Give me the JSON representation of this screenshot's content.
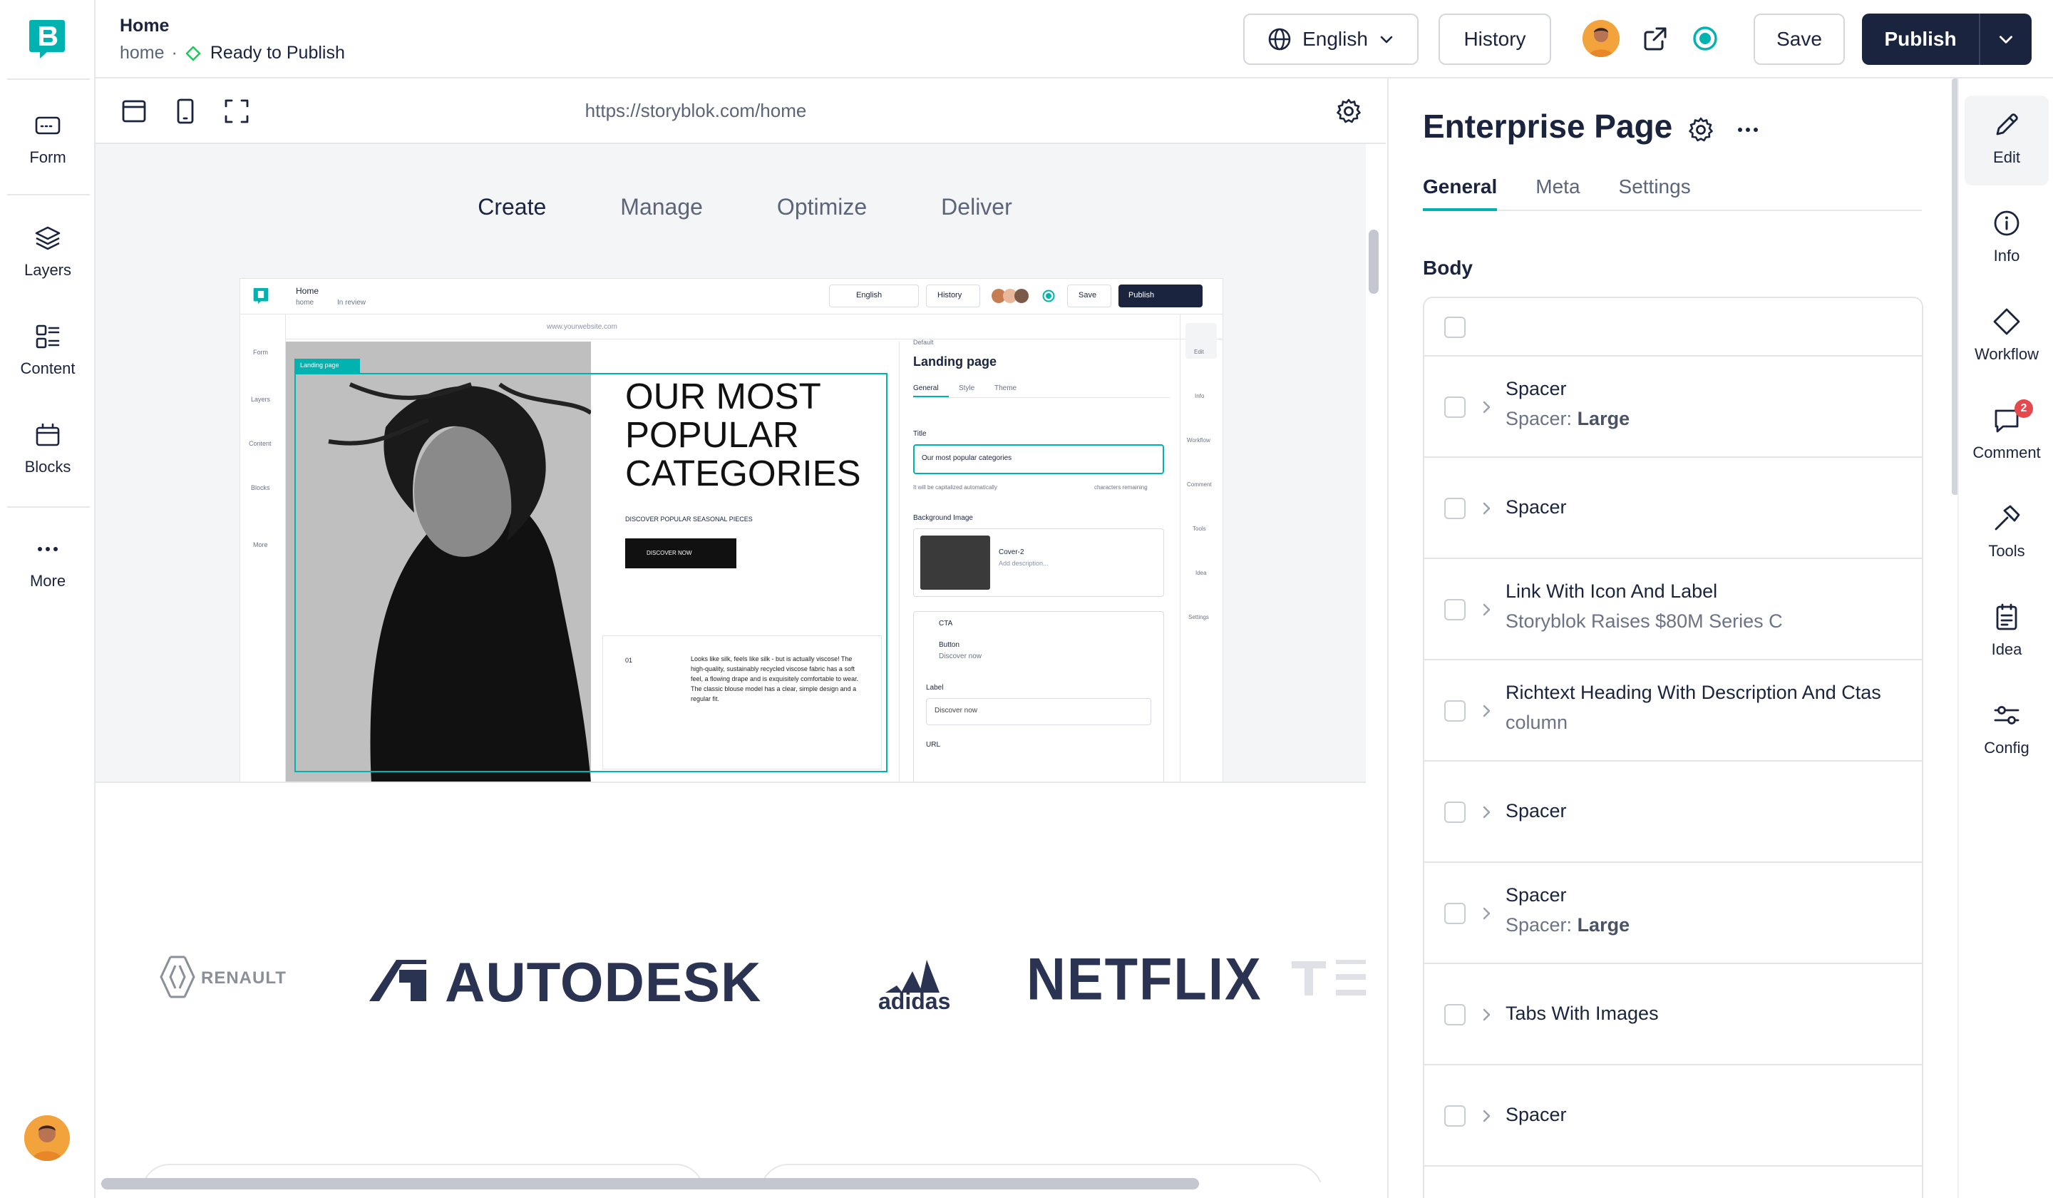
{
  "leftbar": {
    "items": [
      {
        "label": "Form",
        "icon": "form-icon"
      },
      {
        "label": "Layers",
        "icon": "layers-icon"
      },
      {
        "label": "Content",
        "icon": "content-icon"
      },
      {
        "label": "Blocks",
        "icon": "blocks-icon"
      },
      {
        "label": "More",
        "icon": "more-icon"
      }
    ]
  },
  "topbar": {
    "title": "Home",
    "slug": "home",
    "separator": "·",
    "status": "Ready to Publish",
    "language": "English",
    "history_label": "History",
    "save_label": "Save",
    "publish_label": "Publish"
  },
  "preview": {
    "url": "https://storyblok.com/home",
    "tabs": [
      "Create",
      "Manage",
      "Optimize",
      "Deliver"
    ],
    "active_tab": "Create",
    "mini": {
      "title": "Home",
      "slug": "home",
      "status": "In review",
      "language": "English",
      "history": "History",
      "save": "Save",
      "publish": "Publish",
      "url": "www.yourwebsite.com",
      "nav": [
        "Form",
        "Layers",
        "Content",
        "Blocks",
        "More"
      ],
      "tag": "Landing page",
      "heading": "OUR MOST POPULAR CATEGORIES",
      "subheading": "DISCOVER POPULAR SEASONAL PIECES",
      "cta": "DISCOVER NOW",
      "number": "01",
      "description": "Looks like silk, feels like silk - but is actually viscose! The high-quality, sustainably recycled viscose fabric has a soft feel, a flowing drape and is exquisitely comfortable to wear. The classic blouse model has a clear, simple design and a regular fit.",
      "panel_breadcrumb": "Default",
      "panel_title": "Landing page",
      "panel_tabs": [
        "General",
        "Style",
        "Theme"
      ],
      "field_title": "Title",
      "field_title_value": "Our most popular categories",
      "field_hint": "It will be capitalized automatically",
      "field_remaining": "characters remaining",
      "bg_label": "Background Image",
      "asset_name": "Cover-2",
      "asset_desc": "Add description...",
      "cta_label": "CTA",
      "button_label": "Button",
      "button_sub": "Discover now",
      "label_field": "Label",
      "label_value": "Discover now",
      "url_label": "URL",
      "right_nav": [
        "Edit",
        "Info",
        "Workflow",
        "Comment",
        "Tools",
        "Idea",
        "Settings"
      ]
    },
    "logos": [
      "RENAULT",
      "AUTODESK",
      "adidas",
      "NETFLIX"
    ]
  },
  "editor": {
    "title": "Enterprise Page",
    "tabs": [
      "General",
      "Meta",
      "Settings"
    ],
    "active_tab": "General",
    "body_label": "Body",
    "blocks": [
      {
        "name": "",
        "sub_prefix": "",
        "sub_bold": ""
      },
      {
        "name": "Spacer",
        "sub_prefix": "Spacer: ",
        "sub_bold": "Large"
      },
      {
        "name": "Spacer",
        "sub_prefix": "",
        "sub_bold": ""
      },
      {
        "name": "Link With Icon And Label",
        "sub_prefix": "Storyblok Raises $80M Series C",
        "sub_bold": ""
      },
      {
        "name": "Richtext Heading With Description And Ctas",
        "sub_prefix": "column",
        "sub_bold": ""
      },
      {
        "name": "Spacer",
        "sub_prefix": "",
        "sub_bold": ""
      },
      {
        "name": "Spacer",
        "sub_prefix": "Spacer: ",
        "sub_bold": "Large"
      },
      {
        "name": "Tabs With Images",
        "sub_prefix": "",
        "sub_bold": ""
      },
      {
        "name": "Spacer",
        "sub_prefix": "",
        "sub_bold": ""
      }
    ]
  },
  "rightbar": {
    "items": [
      {
        "label": "Edit",
        "icon": "edit-icon"
      },
      {
        "label": "Info",
        "icon": "info-icon"
      },
      {
        "label": "Workflow",
        "icon": "workflow-icon"
      },
      {
        "label": "Comment",
        "icon": "comment-icon"
      },
      {
        "label": "Tools",
        "icon": "tools-icon"
      },
      {
        "label": "Idea",
        "icon": "idea-icon"
      },
      {
        "label": "Config",
        "icon": "config-icon"
      }
    ],
    "comment_badge": "2"
  },
  "colors": {
    "brand": "#00b3b0",
    "navy": "#1b243f",
    "status_green": "#22c55e",
    "badge_red": "#e5484d"
  }
}
